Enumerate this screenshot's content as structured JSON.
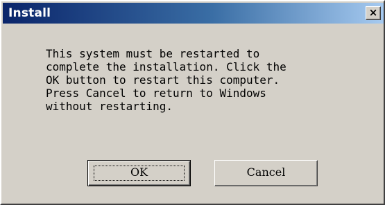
{
  "window": {
    "title": "Install",
    "close_glyph": "×"
  },
  "dialog": {
    "message": "This system must be restarted to\ncomplete the installation. Click the\nOK button to restart this computer.\nPress Cancel to return to Windows\nwithout restarting.",
    "ok_label": "OK",
    "cancel_label": "Cancel"
  },
  "colors": {
    "titlebar_start": "#0a246a",
    "titlebar_end": "#a6caf0",
    "face": "#d4d0c8"
  }
}
